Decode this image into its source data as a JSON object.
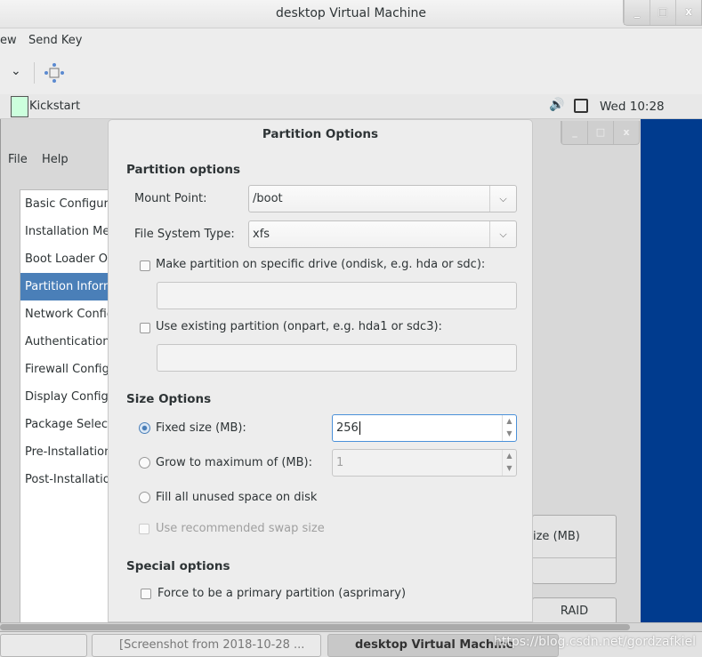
{
  "window": {
    "title": "desktop Virtual Machine",
    "buttons": [
      "_",
      "□",
      "x"
    ]
  },
  "menu": {
    "items": [
      "ew",
      "Send Key"
    ]
  },
  "toolbar": {
    "dropdown": "chevron-down-icon",
    "fit": "resize-icon"
  },
  "guest_topbar": {
    "app": "Kickstart",
    "clock": "Wed 10:28"
  },
  "kickstart": {
    "menu": [
      "File",
      "Help"
    ],
    "sections": [
      "Basic Configuration",
      "Installation Method",
      "Boot Loader Options",
      "Partition Information",
      "Network Configuration",
      "Authentication",
      "Firewall Configuration",
      "Display Configuration",
      "Package Selection",
      "Pre-Installation Script",
      "Post-Installation Script"
    ],
    "selected": 3,
    "column_header": "ize (MB)",
    "raid_button": "RAID"
  },
  "dialog": {
    "title": "Partition Options",
    "partition_header": "Partition options",
    "mount_label": "Mount Point:",
    "mount_value": "/boot",
    "fs_label": "File System Type:",
    "fs_value": "xfs",
    "ondisk_label": "Make partition on specific drive (ondisk, e.g. hda or sdc):",
    "ondisk_value": "",
    "onpart_label": "Use existing partition (onpart, e.g. hda1 or sdc3):",
    "onpart_value": "",
    "size_header": "Size Options",
    "fixed_label": "Fixed size (MB):",
    "fixed_value": "256",
    "grow_label": "Grow to maximum of (MB):",
    "grow_value": "1",
    "fill_label": "Fill all unused space on disk",
    "swap_label": "Use recommended swap size",
    "special_header": "Special options",
    "primary_label": "Force to be a primary partition (asprimary)"
  },
  "taskbar": {
    "items": [
      "[Screenshot from 2018-10-28 ...",
      "desktop Virtual Machine"
    ],
    "watermark": "https://blog.csdn.net/gordzafkiel"
  }
}
